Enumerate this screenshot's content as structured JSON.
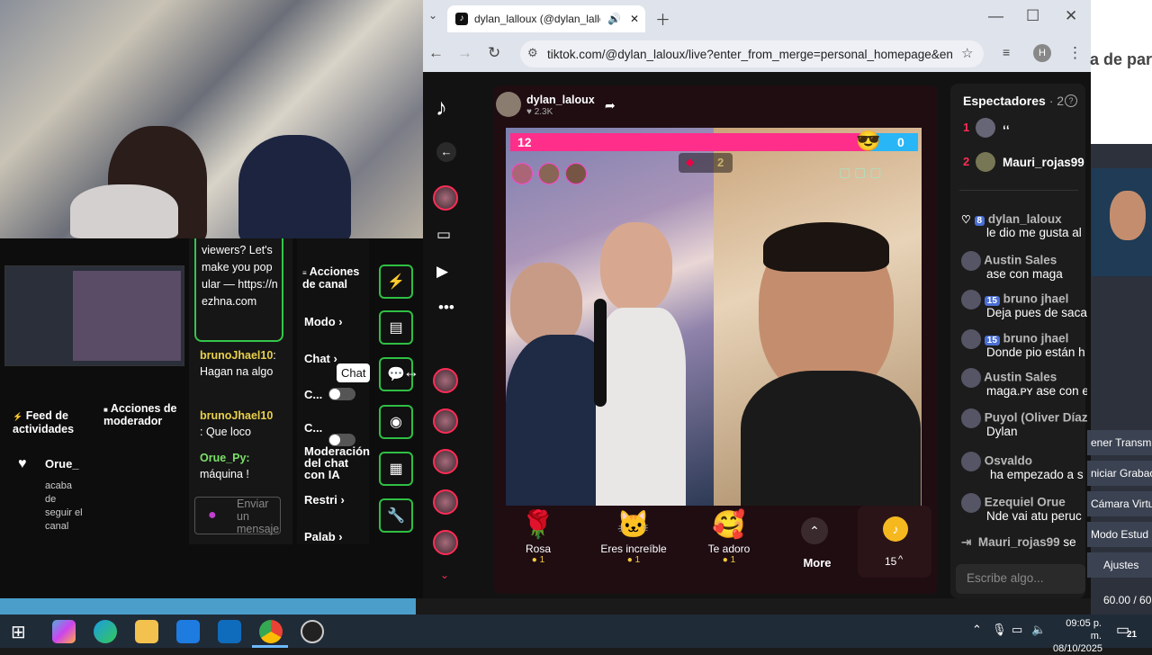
{
  "obs": {
    "chat_messages": [
      {
        "text": "viewers? Let's make you popular — https://nezhna.com"
      },
      {
        "name": "brunoJhael10",
        "text": ": Hagan na algo"
      },
      {
        "name": "brunoJhael10",
        "text": ": Que loco"
      },
      {
        "name": "Orue_Py:",
        "text": "máquina !"
      }
    ],
    "feed_title": "Feed de actividades",
    "feed_user": "Orue_",
    "feed_text": "acaba de seguir el canal",
    "mod_actions": "Acciones de moderador",
    "channel_actions": "Acciones de canal",
    "modo": "Modo",
    "chat": "Chat",
    "c1": "C...",
    "c2": "C...",
    "ia_mod": "Moderación del chat con IA",
    "restri": "Restri",
    "palab": "Palab",
    "send_placeholder": "Enviar un mensaje",
    "tooltip": "Chat"
  },
  "chrome": {
    "tab_title": "dylan_lalloux (@dylan_lalloux)",
    "url": "tiktok.com/@dylan_laloux/live?enter_from_merge=personal_homepage&en...",
    "profile_letter": "H"
  },
  "tiktok": {
    "host_name": "dylan_laloux",
    "host_likes": "2.3K",
    "score_left": "12",
    "score_right": "0",
    "round": "2",
    "gifts": [
      {
        "name": "Rosa",
        "price": "1",
        "emoji": "🌹"
      },
      {
        "name": "Eres increíble",
        "price": "1",
        "emoji": "🐱"
      },
      {
        "name": "Te adoro",
        "price": "1",
        "emoji": "🥰"
      }
    ],
    "more": "More",
    "coins": "15",
    "viewers_title": "Espectadores",
    "viewers_count": "· 2",
    "top_viewers": [
      {
        "rank": "1",
        "name": "ʻʻ"
      },
      {
        "rank": "2",
        "name": "Mauri_rojas99"
      }
    ],
    "comments": [
      {
        "badge": "8",
        "name": "dylan_laloux",
        "text": "le dio me gusta al"
      },
      {
        "name": "Austin Sales",
        "text": "ase con maga"
      },
      {
        "badge": "15",
        "name": "bruno jhael",
        "text": "Deja pues de saca"
      },
      {
        "badge": "15",
        "name": "bruno jhael",
        "text": "Donde pio están h"
      },
      {
        "name": "Austin Sales",
        "text": "maga.ᴘʏ ase con e"
      },
      {
        "name": "Puyol (Oliver Díaz",
        "text": "Dylan"
      },
      {
        "name": "Osvaldo",
        "text": "ha empezado a s"
      },
      {
        "name": "Ezequiel Orue",
        "text": "Nde vai atu peruc"
      }
    ],
    "join_line": {
      "name": "Mauri_rojas99",
      "text": "se"
    },
    "input_placeholder": "Escribe algo..."
  },
  "right_obs": {
    "partial_title": "a de par",
    "buttons": [
      "ener Transm",
      "niciar Grabac",
      "Cámara Virtu",
      "Modo Estud",
      "Ajustes"
    ],
    "fps": "60.00 / 60"
  },
  "taskbar": {
    "time": "09:05 p. m.",
    "date": "08/10/2025",
    "notif_count": "21"
  },
  "colors": {
    "accent_pink": "#fe2c55",
    "green_border": "#2fbf44",
    "tiktok_bg": "#121212"
  }
}
